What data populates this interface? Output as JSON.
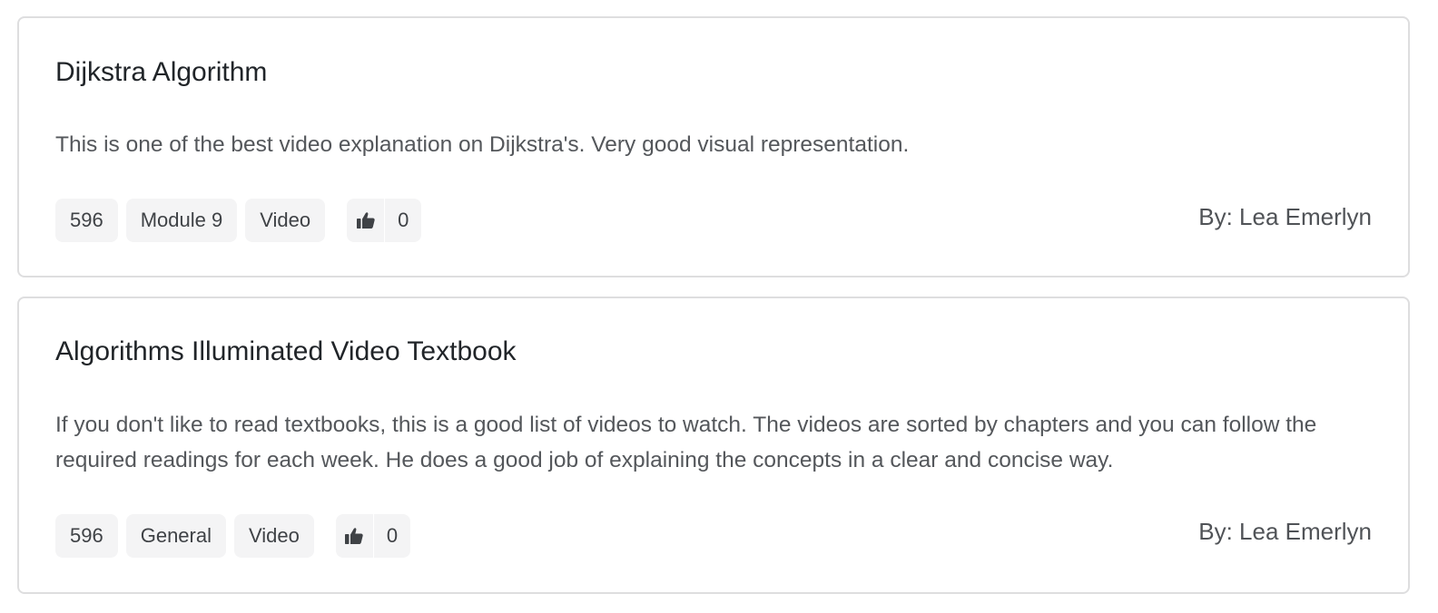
{
  "resources": [
    {
      "title": "Dijkstra Algorithm",
      "description": "This is one of the best video explanation on Dijkstra's. Very good visual representation.",
      "tags": [
        "596",
        "Module 9",
        "Video"
      ],
      "likes": "0",
      "author": "By: Lea Emerlyn"
    },
    {
      "title": "Algorithms Illuminated Video Textbook",
      "description": "If you don't like to read textbooks, this is a good list of videos to watch. The videos are sorted by chapters and you can follow the required readings for each week. He does a good job of explaining the concepts in a clear and concise way.",
      "tags": [
        "596",
        "General",
        "Video"
      ],
      "likes": "0",
      "author": "By: Lea Emerlyn"
    }
  ],
  "icons": {
    "like": "thumbs-up-icon"
  },
  "colors": {
    "card_border": "#dededf",
    "tag_background": "#f4f4f5",
    "title_text": "#212529",
    "body_text": "#54575b"
  }
}
